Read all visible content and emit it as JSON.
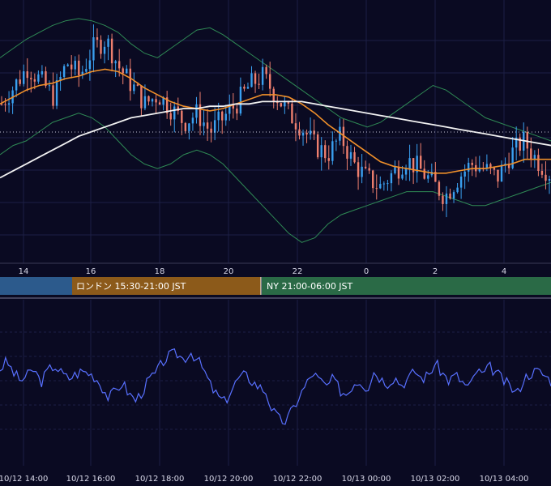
{
  "colors": {
    "background": "#0a0a22",
    "grid": "#1c1f45",
    "candle_up": "#3aa0f0",
    "candle_down": "#ee7f6e",
    "ma_short": "#f0902a",
    "ma_long": "#f2f2f2",
    "bollinger": "#2f8a55",
    "oscillator": "#5870ff",
    "session_tokyo": "#2c5a8c",
    "session_london": "#8c5a1a",
    "session_ny": "#2a6a46",
    "separator": "#7a7a95",
    "current_price_line": "#c8c8d8"
  },
  "sessions": [
    {
      "id": "tokyo",
      "label": "",
      "color": "#2c5a8c"
    },
    {
      "id": "london",
      "label": "ロンドン 15:30-21:00 JST",
      "color": "#8c5a1a"
    },
    {
      "id": "ny",
      "label": "NY 21:00-06:00 JST",
      "color": "#2a6a46"
    }
  ],
  "chart_data": [
    {
      "type": "line",
      "title": "",
      "description": "Price candlestick chart with moving averages and Bollinger Bands",
      "x_ticks": [
        "14",
        "16",
        "18",
        "20",
        "22",
        "0",
        "2",
        "4"
      ],
      "y_ticks": [],
      "series": [
        {
          "role": "candles",
          "values": [
            0.62,
            0.7,
            0.78,
            0.72,
            0.65,
            0.8,
            0.74,
            0.86,
            0.9,
            0.78,
            0.7,
            0.62,
            0.66,
            0.6,
            0.54,
            0.58,
            0.5,
            0.56,
            0.62,
            0.7,
            0.74,
            0.66,
            0.58,
            0.52,
            0.44,
            0.4,
            0.48,
            0.36,
            0.3,
            0.26,
            0.32,
            0.38,
            0.34,
            0.28,
            0.22,
            0.3,
            0.36,
            0.34,
            0.3,
            0.4,
            0.46,
            0.38,
            0.32
          ]
        },
        {
          "role": "ma_short",
          "values": [
            0.62,
            0.65,
            0.68,
            0.7,
            0.71,
            0.73,
            0.74,
            0.76,
            0.77,
            0.76,
            0.73,
            0.69,
            0.66,
            0.63,
            0.61,
            0.6,
            0.59,
            0.6,
            0.62,
            0.64,
            0.66,
            0.66,
            0.65,
            0.62,
            0.58,
            0.53,
            0.49,
            0.45,
            0.41,
            0.37,
            0.35,
            0.34,
            0.33,
            0.32,
            0.32,
            0.33,
            0.34,
            0.34,
            0.35,
            0.36,
            0.38,
            0.38,
            0.38
          ]
        },
        {
          "role": "ma_long",
          "values": [
            0.3,
            0.33,
            0.36,
            0.39,
            0.42,
            0.45,
            0.48,
            0.5,
            0.52,
            0.54,
            0.56,
            0.57,
            0.58,
            0.59,
            0.6,
            0.6,
            0.61,
            0.61,
            0.62,
            0.62,
            0.63,
            0.63,
            0.63,
            0.63,
            0.62,
            0.61,
            0.6,
            0.59,
            0.58,
            0.57,
            0.56,
            0.55,
            0.54,
            0.53,
            0.52,
            0.51,
            0.5,
            0.49,
            0.48,
            0.47,
            0.46,
            0.45,
            0.44
          ]
        },
        {
          "role": "bb_upper",
          "values": [
            0.82,
            0.86,
            0.9,
            0.93,
            0.96,
            0.98,
            0.99,
            0.98,
            0.96,
            0.93,
            0.88,
            0.84,
            0.82,
            0.86,
            0.9,
            0.94,
            0.95,
            0.92,
            0.88,
            0.84,
            0.8,
            0.76,
            0.72,
            0.68,
            0.64,
            0.6,
            0.56,
            0.54,
            0.52,
            0.54,
            0.58,
            0.62,
            0.66,
            0.7,
            0.68,
            0.64,
            0.6,
            0.56,
            0.54,
            0.52,
            0.5,
            0.48,
            0.46
          ]
        },
        {
          "role": "bb_lower",
          "values": [
            0.4,
            0.44,
            0.46,
            0.5,
            0.54,
            0.56,
            0.58,
            0.56,
            0.52,
            0.46,
            0.4,
            0.36,
            0.34,
            0.36,
            0.4,
            0.42,
            0.4,
            0.36,
            0.3,
            0.24,
            0.18,
            0.12,
            0.06,
            0.02,
            0.04,
            0.1,
            0.14,
            0.16,
            0.18,
            0.2,
            0.22,
            0.24,
            0.24,
            0.24,
            0.22,
            0.2,
            0.18,
            0.18,
            0.2,
            0.22,
            0.24,
            0.26,
            0.28
          ]
        }
      ]
    },
    {
      "type": "line",
      "title": "",
      "description": "Oscillator panel",
      "x_ticks": [
        "10/12 14:00",
        "10/12 16:00",
        "10/12 18:00",
        "10/12 20:00",
        "10/12 22:00",
        "10/13 00:00",
        "10/13 02:00",
        "10/13 04:00"
      ],
      "series": [
        {
          "role": "oscillator",
          "values": [
            0.62,
            0.7,
            0.58,
            0.5,
            0.55,
            0.62,
            0.48,
            0.6,
            0.66,
            0.58,
            0.52,
            0.56,
            0.6,
            0.58,
            0.54,
            0.44,
            0.32,
            0.4,
            0.48,
            0.36,
            0.3,
            0.4,
            0.52,
            0.58,
            0.7,
            0.76,
            0.78,
            0.72,
            0.8,
            0.72,
            0.6,
            0.44,
            0.34,
            0.28,
            0.4,
            0.52,
            0.56,
            0.5,
            0.44,
            0.4,
            0.2,
            0.1,
            0.08,
            0.2,
            0.34,
            0.46,
            0.58,
            0.5,
            0.44,
            0.52,
            0.4,
            0.36,
            0.48,
            0.5,
            0.42,
            0.6,
            0.52,
            0.48,
            0.54,
            0.46,
            0.52,
            0.6,
            0.52,
            0.56,
            0.68,
            0.58,
            0.5,
            0.56,
            0.48,
            0.42,
            0.6,
            0.56,
            0.64,
            0.58,
            0.5,
            0.44,
            0.36,
            0.52,
            0.58,
            0.6,
            0.56,
            0.5
          ]
        }
      ]
    }
  ]
}
